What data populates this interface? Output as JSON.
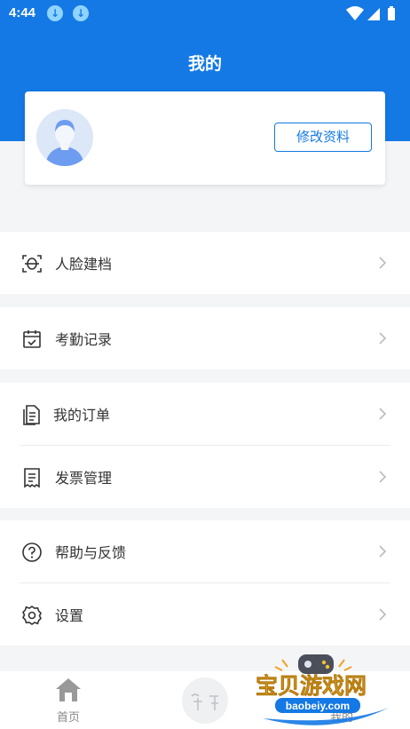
{
  "status": {
    "time": "4:44"
  },
  "header": {
    "title": "我的"
  },
  "profile": {
    "edit_label": "修改资料"
  },
  "menu": [
    {
      "label": "人脸建档",
      "icon": "face-scan-icon"
    },
    {
      "label": "考勤记录",
      "icon": "calendar-check-icon"
    },
    {
      "label": "我的订单",
      "icon": "document-icon"
    },
    {
      "label": "发票管理",
      "icon": "receipt-icon"
    },
    {
      "label": "帮助与反馈",
      "icon": "help-icon"
    },
    {
      "label": "设置",
      "icon": "gear-icon"
    }
  ],
  "tabbar": {
    "home": "首页",
    "mine": "我的"
  },
  "watermark": {
    "cn": "宝贝游戏网",
    "en": "baobeiy.com"
  },
  "colors": {
    "primary": "#1479e4",
    "background": "#f4f5f7"
  }
}
